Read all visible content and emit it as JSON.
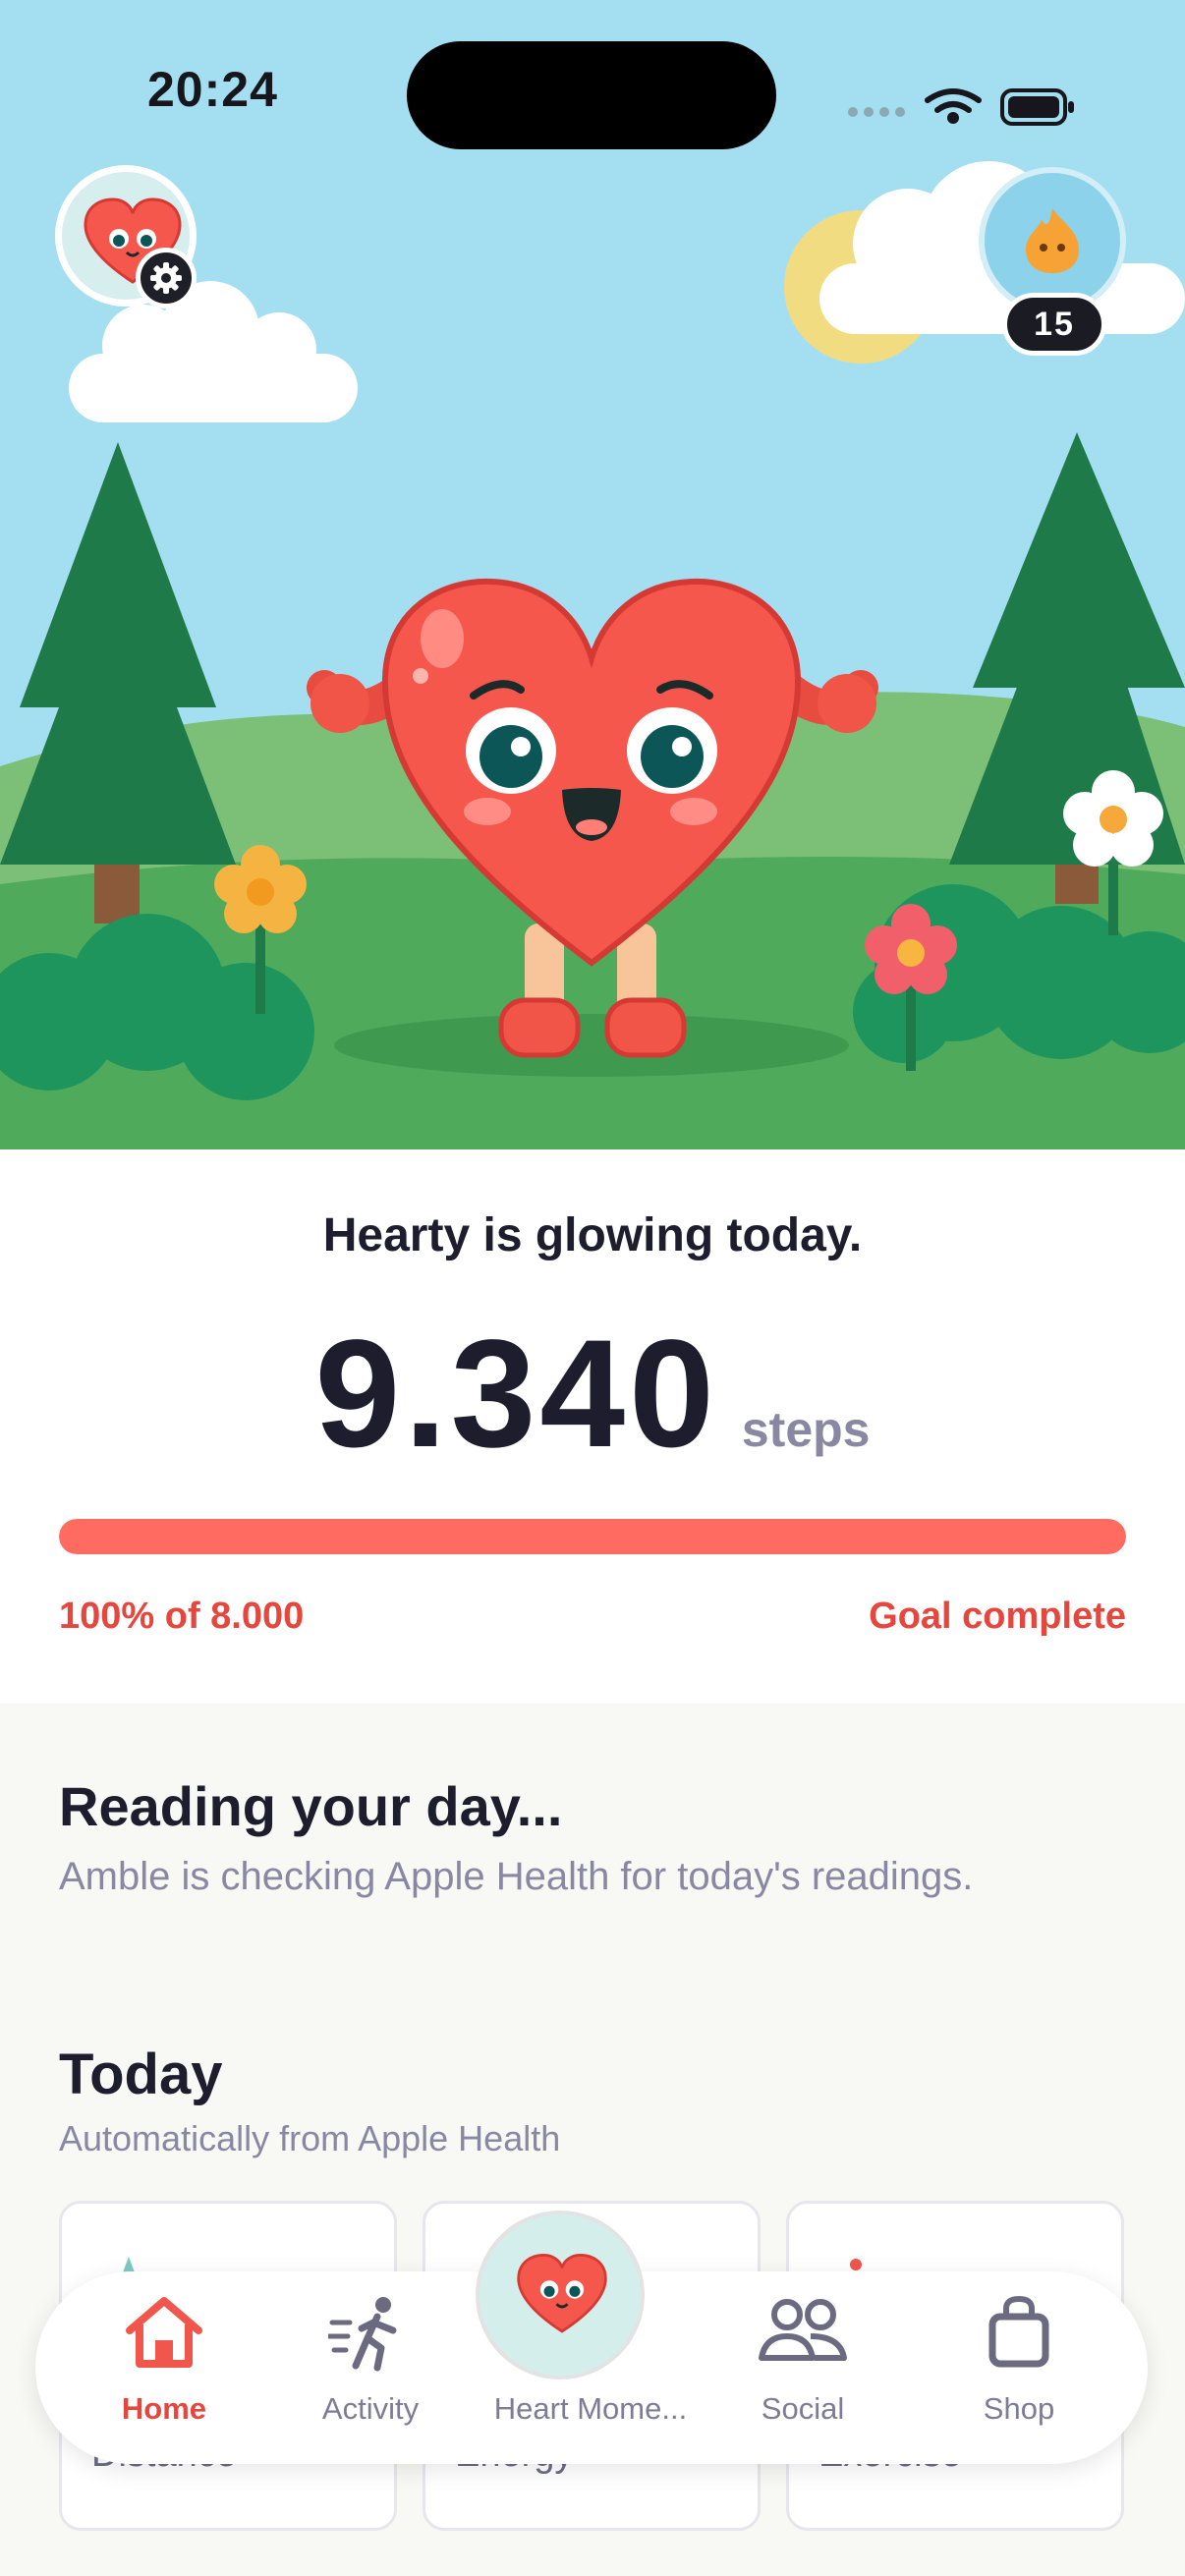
{
  "status_bar": {
    "time": "20:24"
  },
  "hero": {
    "streak_count": "15"
  },
  "steps_card": {
    "headline": "Hearty is glowing today.",
    "step_count": "9.340",
    "unit": "steps",
    "progress_fraction": 1.0,
    "progress_text": "100% of 8.000",
    "status_text": "Goal complete"
  },
  "reading": {
    "title": "Reading your day...",
    "subtitle": "Amble is checking Apple Health for today's readings."
  },
  "today": {
    "title": "Today",
    "subtitle": "Automatically from Apple Health",
    "cards": [
      {
        "label": "Distance",
        "icon": "distance-icon"
      },
      {
        "label": "Energy",
        "icon": "energy-icon"
      },
      {
        "label": "Exercise",
        "icon": "exercise-icon"
      }
    ]
  },
  "tab_bar": {
    "tabs": [
      {
        "label": "Home",
        "icon": "home-icon"
      },
      {
        "label": "Activity",
        "icon": "running-icon"
      },
      {
        "label": "Heart Mome...",
        "icon": "heart-mascot-icon"
      },
      {
        "label": "Social",
        "icon": "people-icon"
      },
      {
        "label": "Shop",
        "icon": "shopping-bag-icon"
      }
    ]
  },
  "colors": {
    "accent": "#ff6b61",
    "accent_text": "#e5463d",
    "sky": "#a4dff1",
    "grass": "#4faa5c",
    "text_primary": "#1d1d2d",
    "text_secondary": "#8a87a3"
  }
}
